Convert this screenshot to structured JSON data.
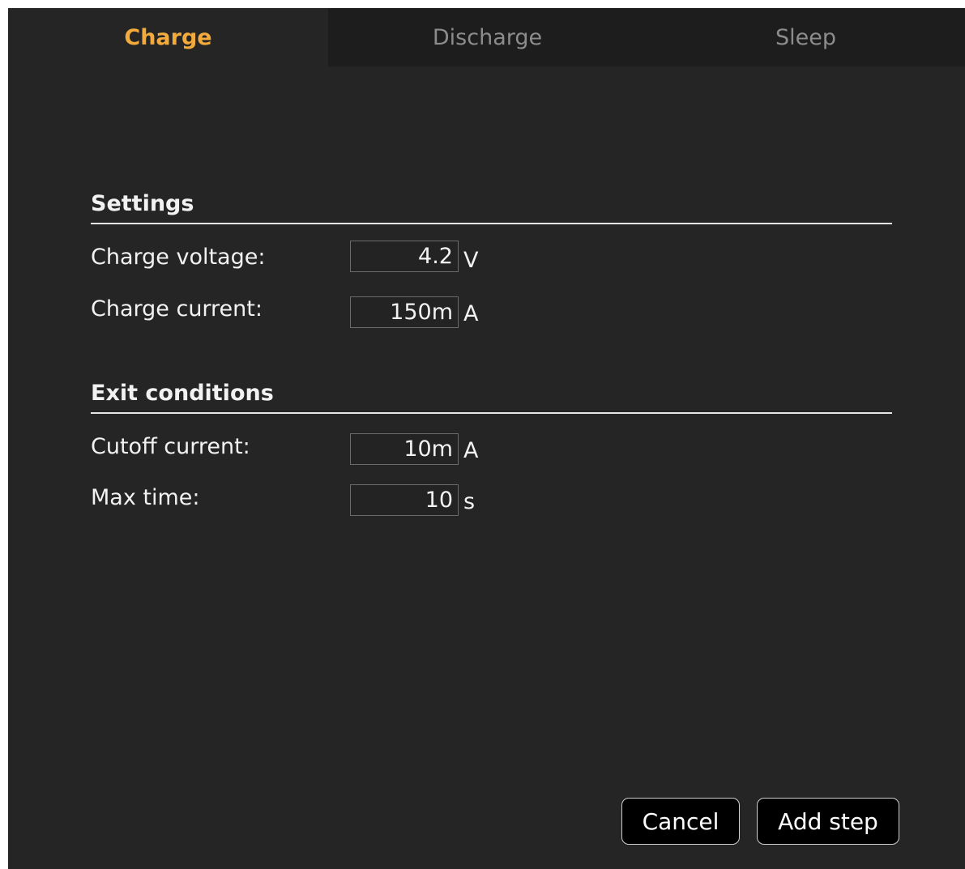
{
  "tabs": [
    {
      "label": "Charge",
      "active": true
    },
    {
      "label": "Discharge",
      "active": false
    },
    {
      "label": "Sleep",
      "active": false
    }
  ],
  "settings": {
    "title": "Settings",
    "fields": [
      {
        "label": "Charge voltage:",
        "value": "4.2",
        "unit": "V"
      },
      {
        "label": "Charge current:",
        "value": "150m",
        "unit": "A"
      }
    ]
  },
  "exit_conditions": {
    "title": "Exit conditions",
    "fields": [
      {
        "label": "Cutoff current:",
        "value": "10m",
        "unit": "A"
      },
      {
        "label": "Max time:",
        "value": "10",
        "unit": "s"
      }
    ]
  },
  "buttons": {
    "cancel": "Cancel",
    "add_step": "Add step"
  },
  "colors": {
    "accent": "#f3aa3c",
    "background": "#252525",
    "inactive_tab": "#1d1d1d"
  }
}
